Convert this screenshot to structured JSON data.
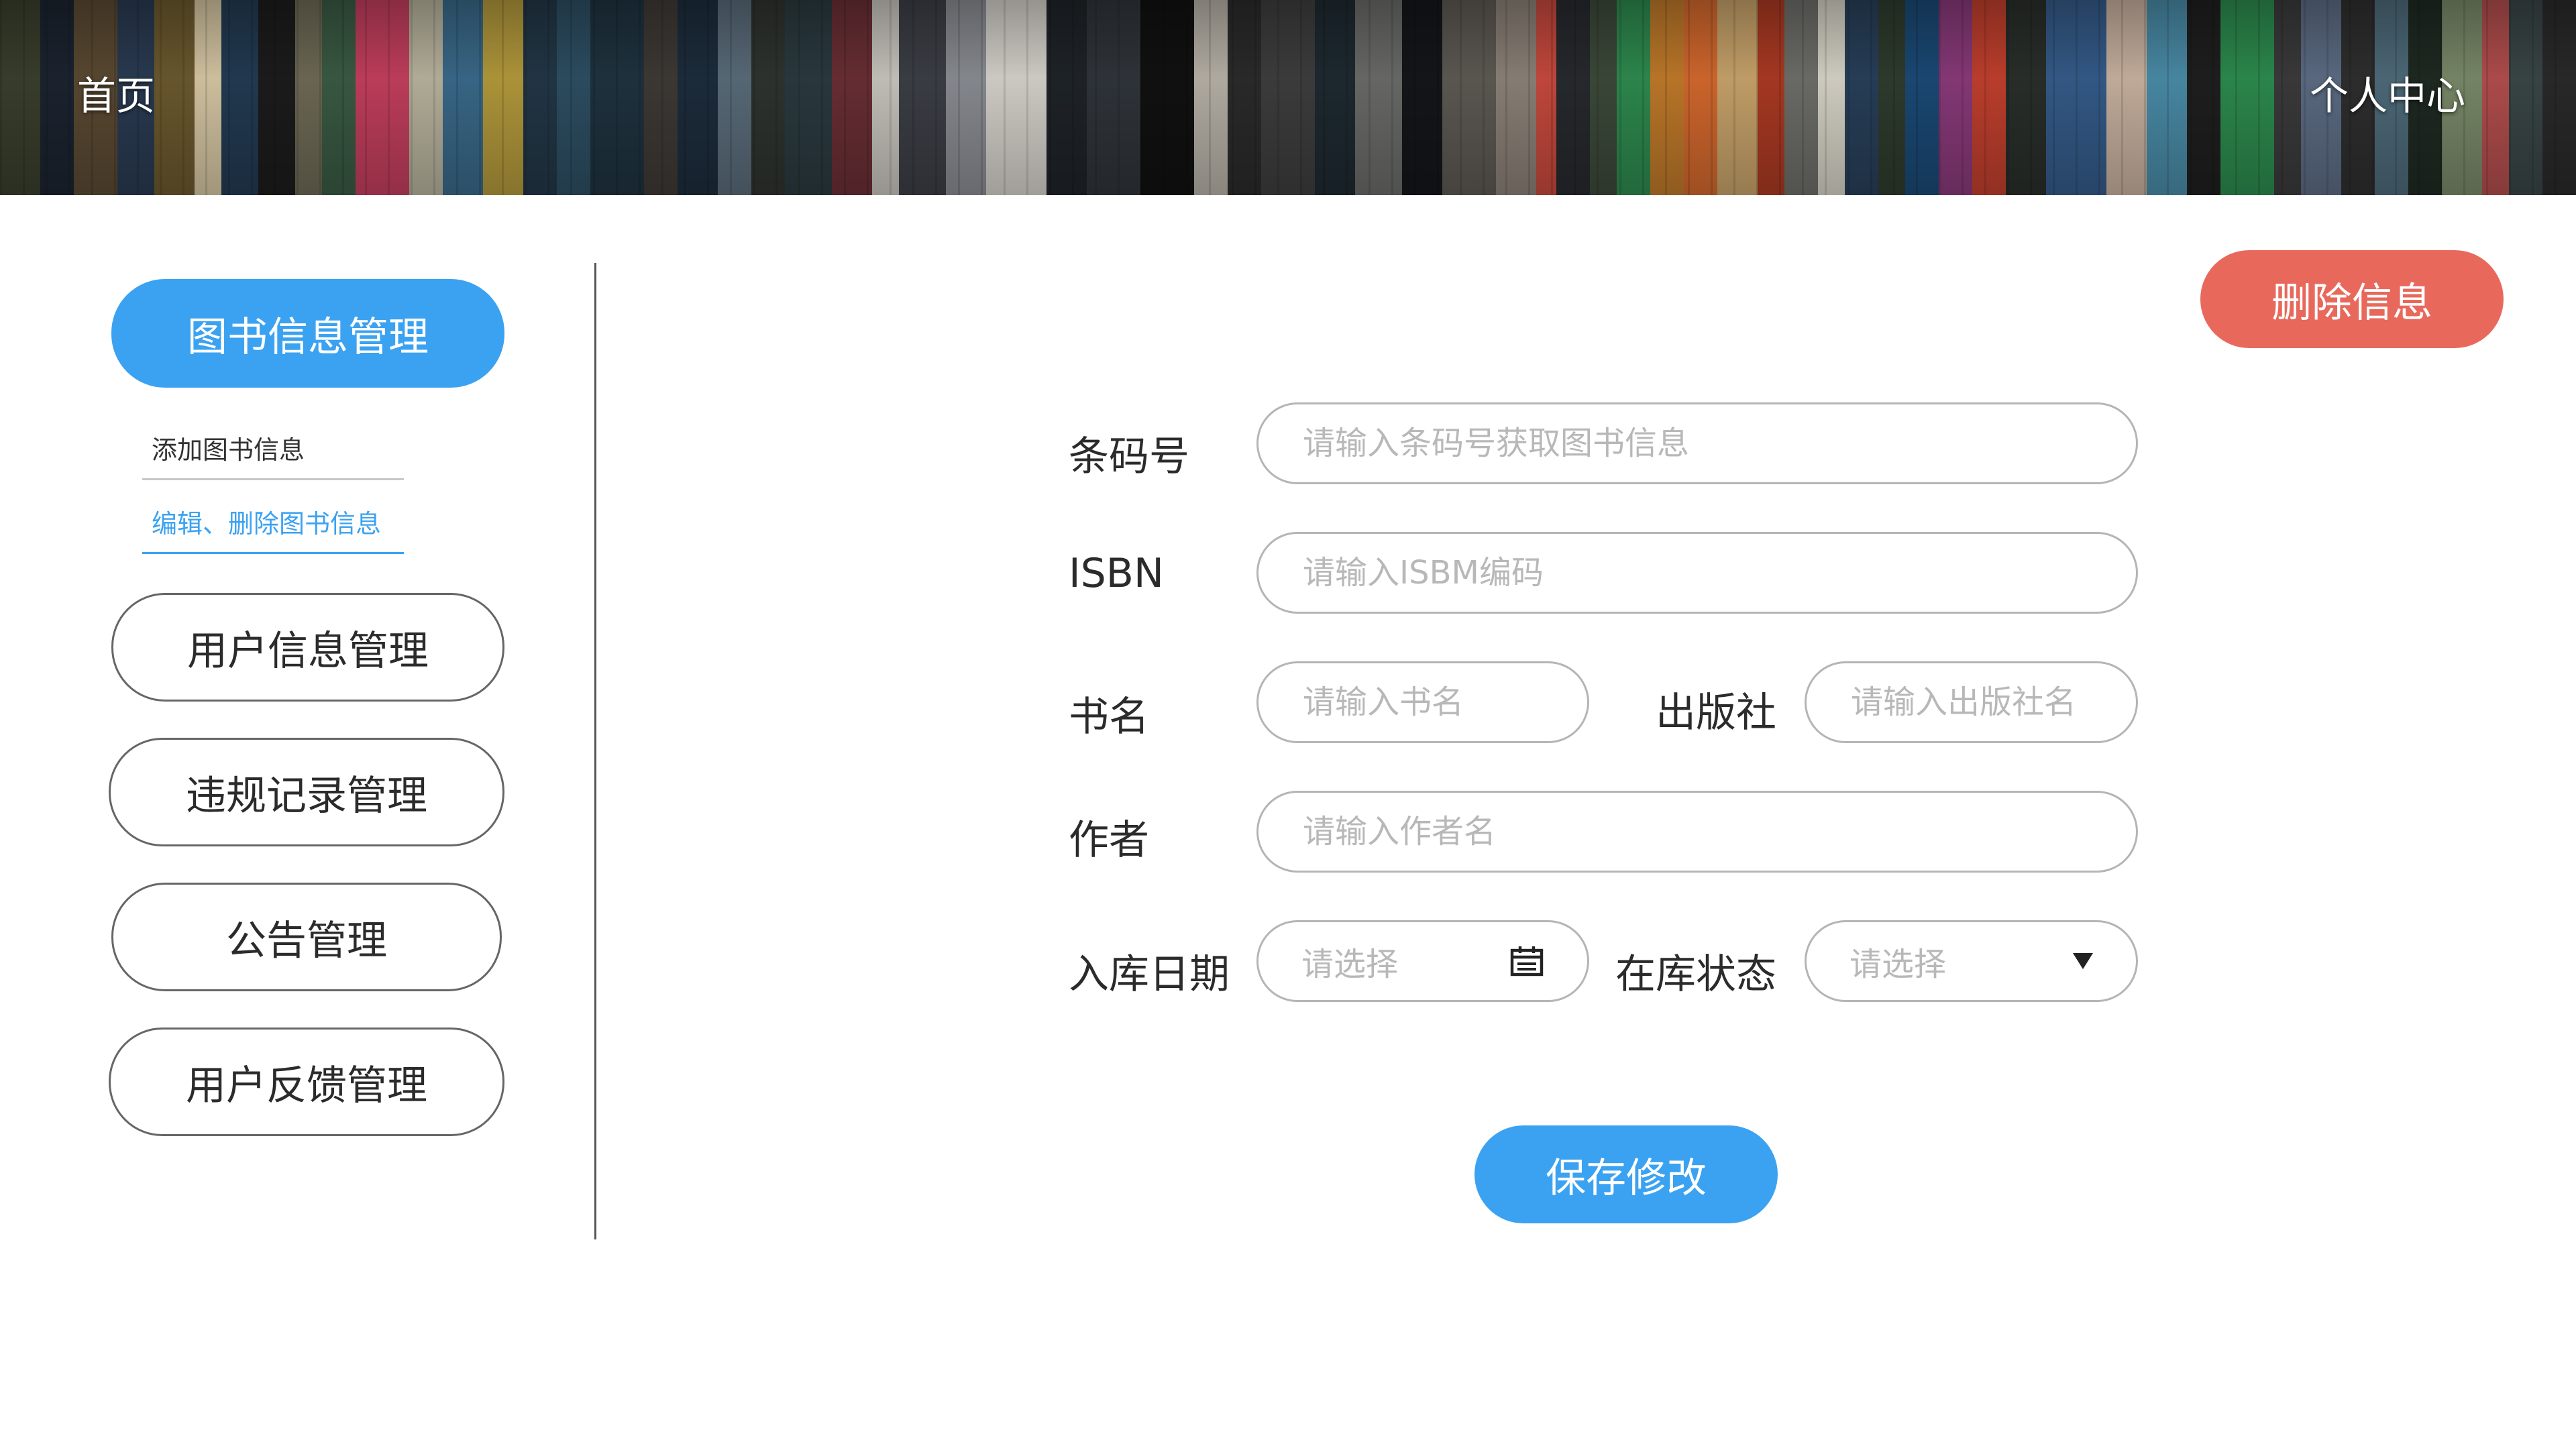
{
  "header": {
    "home_label": "首页",
    "profile_label": "个人中心"
  },
  "sidebar": {
    "items": [
      {
        "label": "图书信息管理",
        "active": true
      },
      {
        "label": "用户信息管理"
      },
      {
        "label": "违规记录管理"
      },
      {
        "label": "公告管理"
      },
      {
        "label": "用户反馈管理"
      }
    ],
    "sub_items": [
      {
        "label": "添加图书信息"
      },
      {
        "label": "编辑、删除图书信息",
        "active": true
      }
    ]
  },
  "form": {
    "barcode": {
      "label": "条码号",
      "placeholder": "请输入条码号获取图书信息"
    },
    "isbn": {
      "label": "ISBN",
      "placeholder": "请输入ISBM编码"
    },
    "title": {
      "label": "书名",
      "placeholder": "请输入书名"
    },
    "publisher": {
      "label": "出版社",
      "placeholder": "请输入出版社名"
    },
    "author": {
      "label": "作者",
      "placeholder": "请输入作者名"
    },
    "storage_date": {
      "label": "入库日期",
      "placeholder": "请选择"
    },
    "stock_status": {
      "label": "在库状态",
      "placeholder": "请选择"
    }
  },
  "actions": {
    "delete_label": "删除信息",
    "save_label": "保存修改"
  },
  "colors": {
    "primary": "#3ba2f2",
    "danger": "#e8695c",
    "border": "#b5b5b5"
  }
}
